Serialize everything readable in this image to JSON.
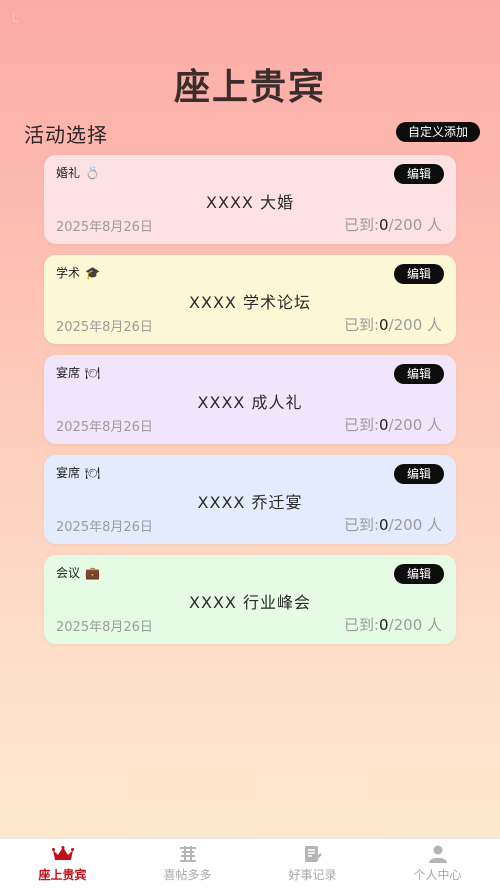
{
  "status": {
    "indicator": "L"
  },
  "app_title": "座上贵宾",
  "section": {
    "title": "活动选择",
    "custom_add_label": "自定义添加"
  },
  "events": [
    {
      "tag": "婚礼",
      "tag_icon": "ring-icon",
      "icon_glyph": "💍",
      "name": "XXXX 大婚",
      "date": "2025年8月26日",
      "arrived_label": "已到:",
      "arrived": "0",
      "total": "/200 人",
      "edit_label": "编辑",
      "bg": "#fde1e3"
    },
    {
      "tag": "学术",
      "tag_icon": "graduation-cap-icon",
      "icon_glyph": "🎓",
      "name": "XXXX 学术论坛",
      "date": "2025年8月26日",
      "arrived_label": "已到:",
      "arrived": "0",
      "total": "/200 人",
      "edit_label": "编辑",
      "bg": "#fcf8d6"
    },
    {
      "tag": "宴席",
      "tag_icon": "plate-icon",
      "icon_glyph": "🍽",
      "name": "XXXX 成人礼",
      "date": "2025年8月26日",
      "arrived_label": "已到:",
      "arrived": "0",
      "total": "/200 人",
      "edit_label": "编辑",
      "bg": "#f1e5fc"
    },
    {
      "tag": "宴席",
      "tag_icon": "plate-icon",
      "icon_glyph": "🍽",
      "name": "XXXX 乔迁宴",
      "date": "2025年8月26日",
      "arrived_label": "已到:",
      "arrived": "0",
      "total": "/200 人",
      "edit_label": "编辑",
      "bg": "#e4ebfd"
    },
    {
      "tag": "会议",
      "tag_icon": "briefcase-icon",
      "icon_glyph": "💼",
      "name": "XXXX 行业峰会",
      "date": "2025年8月26日",
      "arrived_label": "已到:",
      "arrived": "0",
      "total": "/200 人",
      "edit_label": "编辑",
      "bg": "#e5fbe3"
    }
  ],
  "tabbar": {
    "items": [
      {
        "label": "座上贵宾",
        "icon": "crown-icon",
        "active": true
      },
      {
        "label": "喜帖多多",
        "icon": "double-happiness-icon",
        "active": false
      },
      {
        "label": "好事记录",
        "icon": "edit-note-icon",
        "active": false
      },
      {
        "label": "个人中心",
        "icon": "person-icon",
        "active": false
      }
    ]
  },
  "colors": {
    "accent": "#c2101a",
    "button": "#0d0d0d"
  }
}
